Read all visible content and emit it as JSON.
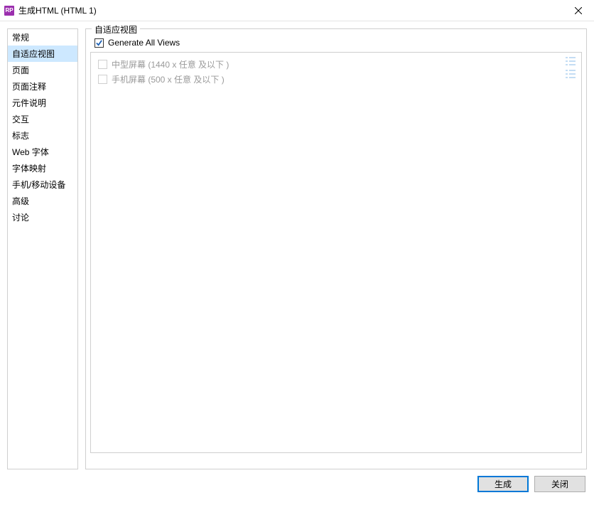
{
  "titlebar": {
    "app_icon_text": "RP",
    "title": "生成HTML (HTML 1)"
  },
  "sidebar": {
    "items": [
      {
        "label": "常规"
      },
      {
        "label": "自适应视图"
      },
      {
        "label": "页面"
      },
      {
        "label": "页面注释"
      },
      {
        "label": "元件说明"
      },
      {
        "label": "交互"
      },
      {
        "label": "标志"
      },
      {
        "label": "Web 字体"
      },
      {
        "label": "字体映射"
      },
      {
        "label": "手机/移动设备"
      },
      {
        "label": "高级"
      },
      {
        "label": "讨论"
      }
    ],
    "selected_index": 1
  },
  "main": {
    "fieldset_label": "自适应视图",
    "generate_all": {
      "label": "Generate All Views",
      "checked": true
    },
    "views": [
      {
        "label": "中型屏幕 (1440 x 任意  及以下 )",
        "checked": false
      },
      {
        "label": "手机屏幕 (500 x 任意  及以下 )",
        "checked": false
      }
    ]
  },
  "footer": {
    "generate_label": "生成",
    "close_label": "关闭"
  }
}
